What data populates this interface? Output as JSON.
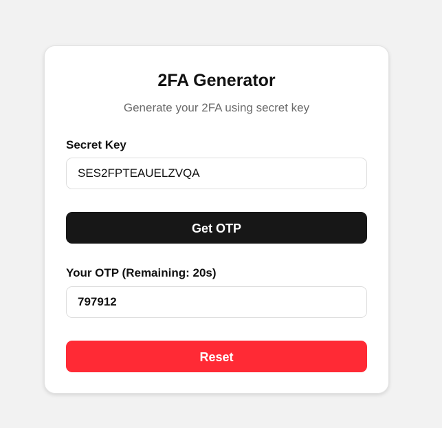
{
  "card": {
    "title": "2FA Generator",
    "subtitle": "Generate your 2FA using secret key"
  },
  "secret_key": {
    "label": "Secret Key",
    "value": "SES2FPTEAUELZVQA"
  },
  "get_otp_button": {
    "label": "Get OTP",
    "color": "#171717"
  },
  "otp": {
    "label": "Your OTP (Remaining: 20s)",
    "value": "797912"
  },
  "reset_button": {
    "label": "Reset",
    "color": "#ff2a35"
  }
}
